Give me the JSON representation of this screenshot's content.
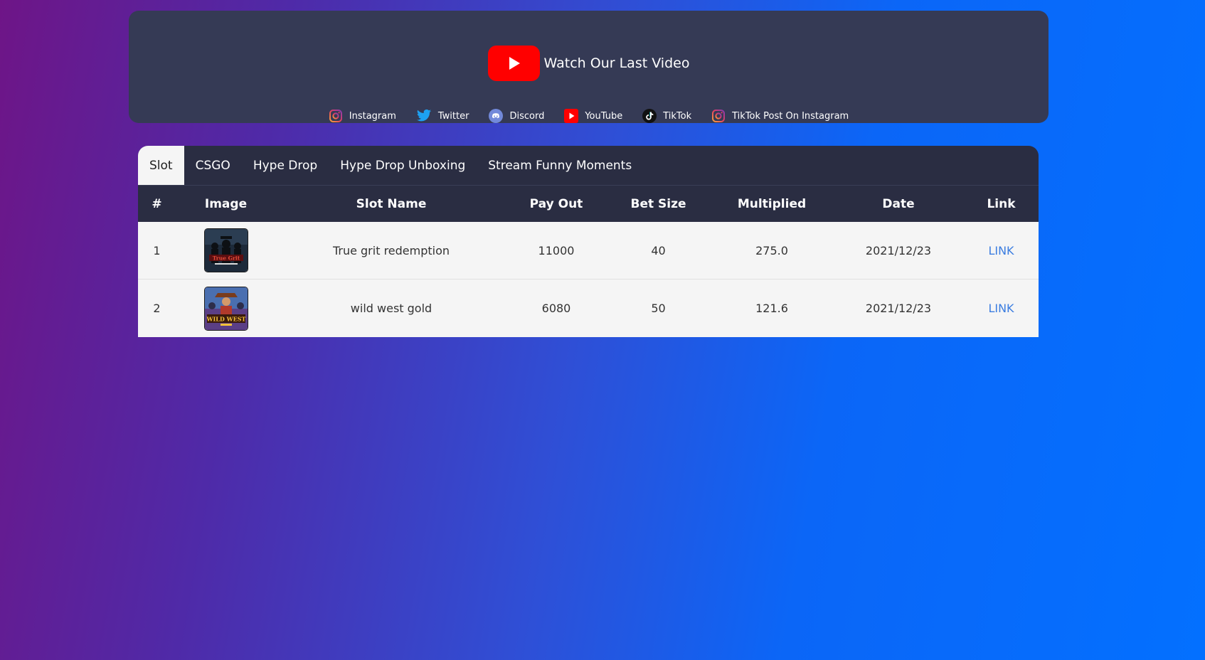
{
  "hero": {
    "watch_label": "Watch Our Last Video",
    "social": [
      {
        "label": "Instagram",
        "icon": "instagram-icon"
      },
      {
        "label": "Twitter",
        "icon": "twitter-icon"
      },
      {
        "label": "Discord",
        "icon": "discord-icon"
      },
      {
        "label": "YouTube",
        "icon": "youtube-icon"
      },
      {
        "label": "TikTok",
        "icon": "tiktok-icon"
      },
      {
        "label": "TikTok Post On Instagram",
        "icon": "instagram-icon"
      }
    ]
  },
  "tabs": [
    "Slot",
    "CSGO",
    "Hype Drop",
    "Hype Drop Unboxing",
    "Stream Funny Moments"
  ],
  "active_tab": "Slot",
  "table": {
    "headers": [
      "#",
      "Image",
      "Slot Name",
      "Pay Out",
      "Bet Size",
      "Multiplied",
      "Date",
      "Link"
    ],
    "rows": [
      {
        "num": "1",
        "image": "True Grit",
        "name": "True grit redemption",
        "payout": "11000",
        "bet": "40",
        "multiplied": "275.0",
        "date": "2021/12/23",
        "link": "LINK"
      },
      {
        "num": "2",
        "image": "WILD WEST",
        "name": "wild west gold",
        "payout": "6080",
        "bet": "50",
        "multiplied": "121.6",
        "date": "2021/12/23",
        "link": "LINK"
      }
    ]
  },
  "colors": {
    "youtube_red": "#ff0000",
    "panel": "#353a55",
    "table_header": "#2a2d42",
    "link": "#3b7de0"
  }
}
